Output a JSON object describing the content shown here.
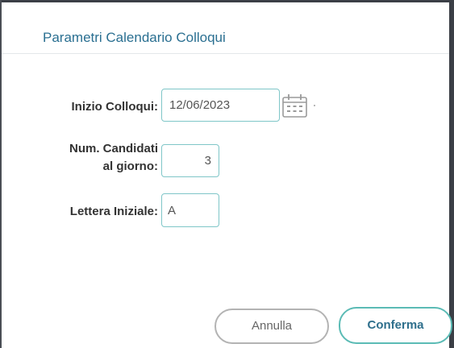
{
  "dialog": {
    "title": "Parametri Calendario Colloqui"
  },
  "form": {
    "inizio": {
      "label": "Inizio Colloqui:",
      "value": "12/06/2023",
      "icon": "calendar-icon"
    },
    "candidati": {
      "label_line1": "Num. Candidati",
      "label_line2": "al giorno:",
      "value": "3"
    },
    "lettera": {
      "label": "Lettera Iniziale:",
      "value": "A"
    }
  },
  "buttons": {
    "cancel_label": "Annulla",
    "confirm_label": "Conferma"
  },
  "colors": {
    "title": "#2a6f91",
    "field_border": "#7fc6c8",
    "confirm_border": "#5bbbb5",
    "cancel_border": "#b3b3b3"
  }
}
